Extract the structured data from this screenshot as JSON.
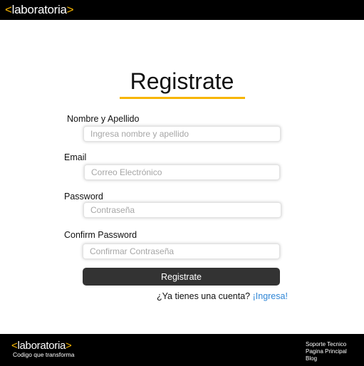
{
  "header": {
    "logo": {
      "open": "<",
      "text": "laboratoria",
      "close": ">"
    }
  },
  "form": {
    "title": "Registrate",
    "fields": [
      {
        "label": "Nombre y Apellido",
        "placeholder": "Ingresa nombre y apellido",
        "value": ""
      },
      {
        "label": "Email",
        "placeholder": "Correo Electrónico",
        "value": ""
      },
      {
        "label": "Password",
        "placeholder": "Contraseña",
        "value": ""
      },
      {
        "label": "Confirm Password",
        "placeholder": "Confirmar Contraseña",
        "value": ""
      }
    ],
    "submit_label": "Registrate",
    "login_prompt": "¿Ya tienes una cuenta?",
    "login_link": "¡Ingresa!"
  },
  "footer": {
    "logo": {
      "open": "<",
      "text": "laboratoria",
      "close": ">"
    },
    "tagline": "Codigo que transforma",
    "links": [
      "Soporte Tecnico",
      "Pagina Principal",
      "Blog"
    ]
  },
  "colors": {
    "accent": "#f7b500",
    "link": "#2f86d6",
    "button": "#333333",
    "bar": "#000000"
  }
}
